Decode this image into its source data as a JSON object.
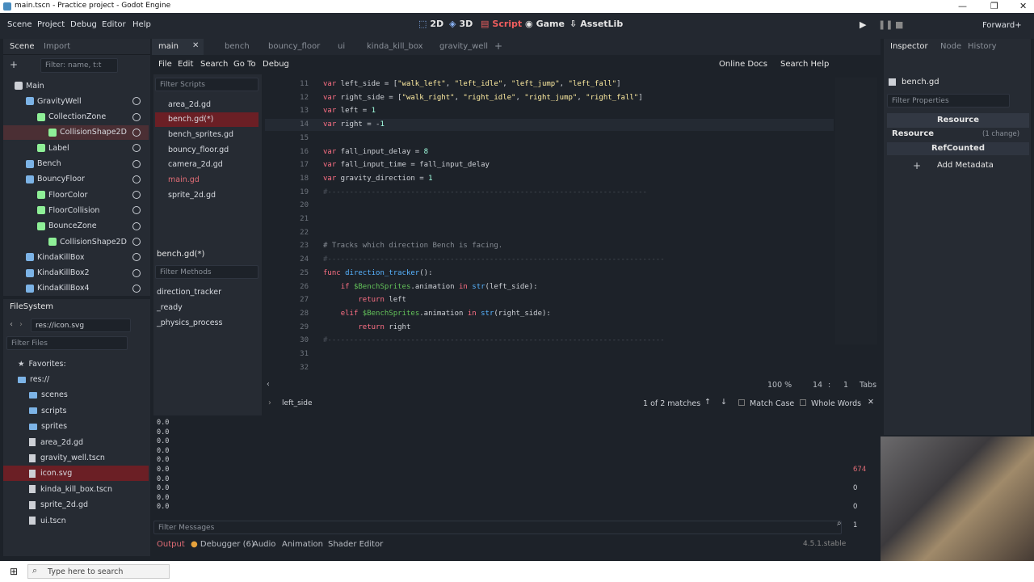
{
  "window": {
    "title": "main.tscn - Practice project - Godot Engine",
    "min": "—",
    "max": "❐",
    "close": "✕"
  },
  "menu": [
    "Scene",
    "Project",
    "Debug",
    "Editor",
    "Help"
  ],
  "workspaces": [
    {
      "label": "2D",
      "icon": "2d-icon"
    },
    {
      "label": "3D",
      "icon": "3d-icon"
    },
    {
      "label": "Script",
      "icon": "script-icon"
    },
    {
      "label": "Game",
      "icon": "game-icon"
    },
    {
      "label": "AssetLib",
      "icon": "assetlib-icon"
    }
  ],
  "renderer": "Forward+",
  "scene_dock": {
    "tabs": [
      "Scene",
      "Import"
    ],
    "filter_placeholder": "Filter: name, t:t",
    "nodes": [
      {
        "name": "Main",
        "depth": 0,
        "color": "#cdd0d6"
      },
      {
        "name": "GravityWell",
        "depth": 1,
        "color": "#7cb3e6"
      },
      {
        "name": "CollectionZone",
        "depth": 2,
        "color": "#8eef97"
      },
      {
        "name": "CollisionShape2D",
        "depth": 3,
        "color": "#8eef97",
        "sel": true
      },
      {
        "name": "Label",
        "depth": 2,
        "color": "#8eef97"
      },
      {
        "name": "Bench",
        "depth": 1,
        "color": "#7cb3e6"
      },
      {
        "name": "BouncyFloor",
        "depth": 1,
        "color": "#7cb3e6"
      },
      {
        "name": "FloorColor",
        "depth": 2,
        "color": "#8eef97"
      },
      {
        "name": "FloorCollision",
        "depth": 2,
        "color": "#8eef97"
      },
      {
        "name": "BounceZone",
        "depth": 2,
        "color": "#8eef97"
      },
      {
        "name": "CollisionShape2D",
        "depth": 3,
        "color": "#8eef97"
      },
      {
        "name": "KindaKillBox",
        "depth": 1,
        "color": "#7cb3e6"
      },
      {
        "name": "KindaKillBox2",
        "depth": 1,
        "color": "#7cb3e6"
      },
      {
        "name": "KindaKillBox4",
        "depth": 1,
        "color": "#7cb3e6"
      }
    ]
  },
  "filesystem": {
    "title": "FileSystem",
    "path": "res://icon.svg",
    "filter_placeholder": "Filter Files",
    "favorites": "Favorites:",
    "items": [
      {
        "name": "res://",
        "type": "folder",
        "depth": 0
      },
      {
        "name": "scenes",
        "type": "folder",
        "depth": 1
      },
      {
        "name": "scripts",
        "type": "folder",
        "depth": 1
      },
      {
        "name": "sprites",
        "type": "folder",
        "depth": 1
      },
      {
        "name": "area_2d.gd",
        "type": "file",
        "depth": 1
      },
      {
        "name": "gravity_well.tscn",
        "type": "file",
        "depth": 1
      },
      {
        "name": "icon.svg",
        "type": "file",
        "depth": 1,
        "sel": true
      },
      {
        "name": "kinda_kill_box.tscn",
        "type": "file",
        "depth": 1
      },
      {
        "name": "sprite_2d.gd",
        "type": "file",
        "depth": 1
      },
      {
        "name": "ui.tscn",
        "type": "file",
        "depth": 1
      }
    ]
  },
  "scene_tabs": [
    {
      "label": "main",
      "active": true
    },
    {
      "label": "bench"
    },
    {
      "label": "bouncy_floor"
    },
    {
      "label": "ui"
    },
    {
      "label": "kinda_kill_box"
    },
    {
      "label": "gravity_well"
    }
  ],
  "script_menu": [
    "File",
    "Edit",
    "Search",
    "Go To",
    "Debug"
  ],
  "online_docs": "Online Docs",
  "search_help": "Search Help",
  "script_filter": "Filter Scripts",
  "scripts": [
    {
      "name": "area_2d.gd"
    },
    {
      "name": "bench.gd(*)",
      "sel": true
    },
    {
      "name": "bench_sprites.gd"
    },
    {
      "name": "bouncy_floor.gd"
    },
    {
      "name": "camera_2d.gd"
    },
    {
      "name": "main.gd",
      "red": true
    },
    {
      "name": "sprite_2d.gd"
    }
  ],
  "current_script": "bench.gd(*)",
  "method_filter": "Filter Methods",
  "methods": [
    "direction_tracker",
    "_ready",
    "_physics_process"
  ],
  "code_lines": [
    {
      "n": "11",
      "t": "var left_side = [\"walk_left\", \"left_idle\", \"left_jump\", \"left_fall\"]"
    },
    {
      "n": "12",
      "t": "var right_side = [\"walk_right\", \"right_idle\", \"right_jump\", \"right_fall\"]"
    },
    {
      "n": "13",
      "t": "var left = 1"
    },
    {
      "n": "14",
      "t": "var right = -1"
    },
    {
      "n": "15",
      "t": ""
    },
    {
      "n": "16",
      "t": "var fall_input_delay = 8"
    },
    {
      "n": "17",
      "t": "var fall_input_time = fall_input_delay"
    },
    {
      "n": "18",
      "t": "var gravity_direction = 1"
    },
    {
      "n": "19",
      "t": "#-------------------------------------------------------------------------"
    },
    {
      "n": "20",
      "t": ""
    },
    {
      "n": "21",
      "t": ""
    },
    {
      "n": "22",
      "t": ""
    },
    {
      "n": "23",
      "t": "# Tracks which direction Bench is facing."
    },
    {
      "n": "24",
      "t": "#-----------------------------------------------------------------------------"
    },
    {
      "n": "25",
      "t": "func direction_tracker():"
    },
    {
      "n": "26",
      "t": "    if $BenchSprites.animation in str(left_side):"
    },
    {
      "n": "27",
      "t": "        return left"
    },
    {
      "n": "28",
      "t": "    elif $BenchSprites.animation in str(right_side):"
    },
    {
      "n": "29",
      "t": "        return right"
    },
    {
      "n": "30",
      "t": "#-----------------------------------------------------------------------------"
    },
    {
      "n": "31",
      "t": ""
    },
    {
      "n": "32",
      "t": ""
    }
  ],
  "status": {
    "zoom": "100 %",
    "line": "14",
    "col": "1",
    "indent": "Tabs"
  },
  "find": {
    "value": "left_side",
    "matches": "1 of 2 matches",
    "match_case": "Match Case",
    "whole_words": "Whole Words"
  },
  "output_lines": [
    "0.0",
    "0.0",
    "0.0",
    "0.0",
    "0.0",
    "0.0",
    "0.0",
    "0.0",
    "0.0",
    "0.0"
  ],
  "filter_messages": "Filter Messages",
  "counts": {
    "errors": "674",
    "warnings": "0",
    "infos": "0",
    "other": "1"
  },
  "bottom_tabs": [
    "Output",
    "Debugger (6)",
    "Audio",
    "Animation",
    "Shader Editor"
  ],
  "version": "4.5.1.stable",
  "inspector": {
    "tabs": [
      "Inspector",
      "Node",
      "History"
    ],
    "resource_name": "bench.gd",
    "filter": "Filter Properties",
    "section": "Resource",
    "subsection": "Resource",
    "change": "(1 change)",
    "refcounted": "RefCounted",
    "add_metadata": "Add Metadata"
  },
  "taskbar": {
    "search": "Type here to search"
  }
}
